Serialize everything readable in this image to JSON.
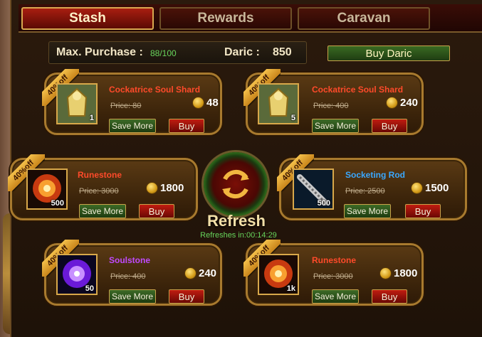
{
  "tabs": [
    {
      "label": "Stash",
      "active": true
    },
    {
      "label": "Rewards",
      "active": false
    },
    {
      "label": "Caravan",
      "active": false
    }
  ],
  "info": {
    "max_purchase_label": "Max. Purchase :",
    "max_purchase_value": "88/100",
    "daric_label": "Daric :",
    "daric_value": "850",
    "buy_daric_label": "Buy Daric"
  },
  "items": [
    {
      "badge": "40%off",
      "name": "Cockatrice Soul Shard",
      "name_color": "#ff4a2a",
      "price": "Price: 80",
      "cost": "48",
      "qty": "1",
      "save_more": "Save More",
      "buy": "Buy",
      "icon": "cockatrice-armor-icon"
    },
    {
      "badge": "40%off",
      "name": "Cockatrice Soul Shard",
      "name_color": "#ff4a2a",
      "price": "Price: 400",
      "cost": "240",
      "qty": "5",
      "save_more": "Save More",
      "buy": "Buy",
      "icon": "cockatrice-armor-icon"
    },
    {
      "badge": "40%off",
      "name": "Runestone",
      "name_color": "#ff4a2a",
      "price": "Price: 3000",
      "cost": "1800",
      "qty": "500",
      "save_more": "Save More",
      "buy": "Buy",
      "icon": "runestone-icon"
    },
    {
      "badge": "40%off",
      "name": "Socketing Rod",
      "name_color": "#3aa8ff",
      "price": "Price: 2500",
      "cost": "1500",
      "qty": "500",
      "save_more": "Save More",
      "buy": "Buy",
      "icon": "socketing-rod-icon"
    },
    {
      "badge": "40%off",
      "name": "Soulstone",
      "name_color": "#c04aff",
      "price": "Price: 400",
      "cost": "240",
      "qty": "50",
      "save_more": "Save More",
      "buy": "Buy",
      "icon": "soulstone-icon"
    },
    {
      "badge": "40%off",
      "name": "Runestone",
      "name_color": "#ff4a2a",
      "price": "Price: 3000",
      "cost": "1800",
      "qty": "1k",
      "save_more": "Save More",
      "buy": "Buy",
      "icon": "runestone-icon"
    }
  ],
  "refresh": {
    "label": "Refresh",
    "timer": "Refreshes in:00:14:29"
  }
}
